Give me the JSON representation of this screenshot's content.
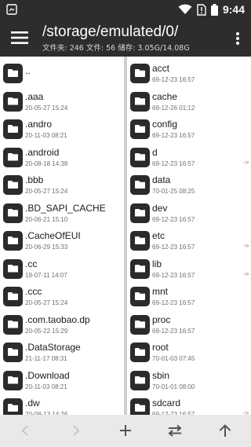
{
  "status": {
    "time": "9:44",
    "icons": [
      "notification-icon",
      "wifi-icon",
      "sim-no-signal-icon",
      "battery-icon"
    ]
  },
  "toolbar": {
    "path": "/storage/emulated/0/",
    "stats": "文件夹: 246  文件: 56  储存: 3.05G/14.08G",
    "menu_icon": "hamburger-menu-icon",
    "more_icon": "more-vert-icon"
  },
  "left_pane": {
    "items": [
      {
        "name": "..",
        "date": ""
      },
      {
        "name": ".aaa",
        "date": "20-05-27 15:24"
      },
      {
        "name": ".andro",
        "date": "20-11-03 08:21"
      },
      {
        "name": ".android",
        "date": "20-08-18 14:38"
      },
      {
        "name": ".bbb",
        "date": "20-05-27 15:24"
      },
      {
        "name": ".BD_SAPI_CACHE",
        "date": "20-06-21 15:10"
      },
      {
        "name": ".CacheOfEUI",
        "date": "20-06-29 15:33"
      },
      {
        "name": ".cc",
        "date": "19-07-11 14:07"
      },
      {
        "name": ".ccc",
        "date": "20-05-27 15:24"
      },
      {
        "name": ".com.taobao.dp",
        "date": "20-05-22 15:29"
      },
      {
        "name": ".DataStorage",
        "date": "21-11-17 08:31"
      },
      {
        "name": ".Download",
        "date": "20-11-03 08:21"
      },
      {
        "name": ".dw",
        "date": "20-08-13 14:26"
      }
    ]
  },
  "right_pane": {
    "items": [
      {
        "name": "acct",
        "date": "69-12-23 16:57",
        "link": ""
      },
      {
        "name": "cache",
        "date": "69-12-26 01:12",
        "link": ""
      },
      {
        "name": "config",
        "date": "69-12-23 16:57",
        "link": ""
      },
      {
        "name": "d",
        "date": "69-12-23 16:57",
        "link": "->"
      },
      {
        "name": "data",
        "date": "70-01-25 08:25",
        "link": ""
      },
      {
        "name": "dev",
        "date": "69-12-23 16:57",
        "link": ""
      },
      {
        "name": "etc",
        "date": "69-12-23 16:57",
        "link": "->"
      },
      {
        "name": "lib",
        "date": "69-12-23 16:57",
        "link": "->"
      },
      {
        "name": "mnt",
        "date": "69-12-23 16:57",
        "link": ""
      },
      {
        "name": "proc",
        "date": "69-12-23 16:57",
        "link": ""
      },
      {
        "name": "root",
        "date": "70-01-03 07:45",
        "link": ""
      },
      {
        "name": "sbin",
        "date": "70-01-01 08:00",
        "link": ""
      },
      {
        "name": "sdcard",
        "date": "69-12-23 16:57",
        "link": "->"
      }
    ]
  },
  "bottom_bar": {
    "buttons": [
      "back-icon",
      "forward-icon",
      "add-icon",
      "swap-panes-icon",
      "up-directory-icon"
    ]
  },
  "colors": {
    "bar": "#2d2d2d",
    "folder": "#2b2b2b",
    "divider": "#cfcfcf",
    "bottom_bar": "#e9e9e9"
  }
}
